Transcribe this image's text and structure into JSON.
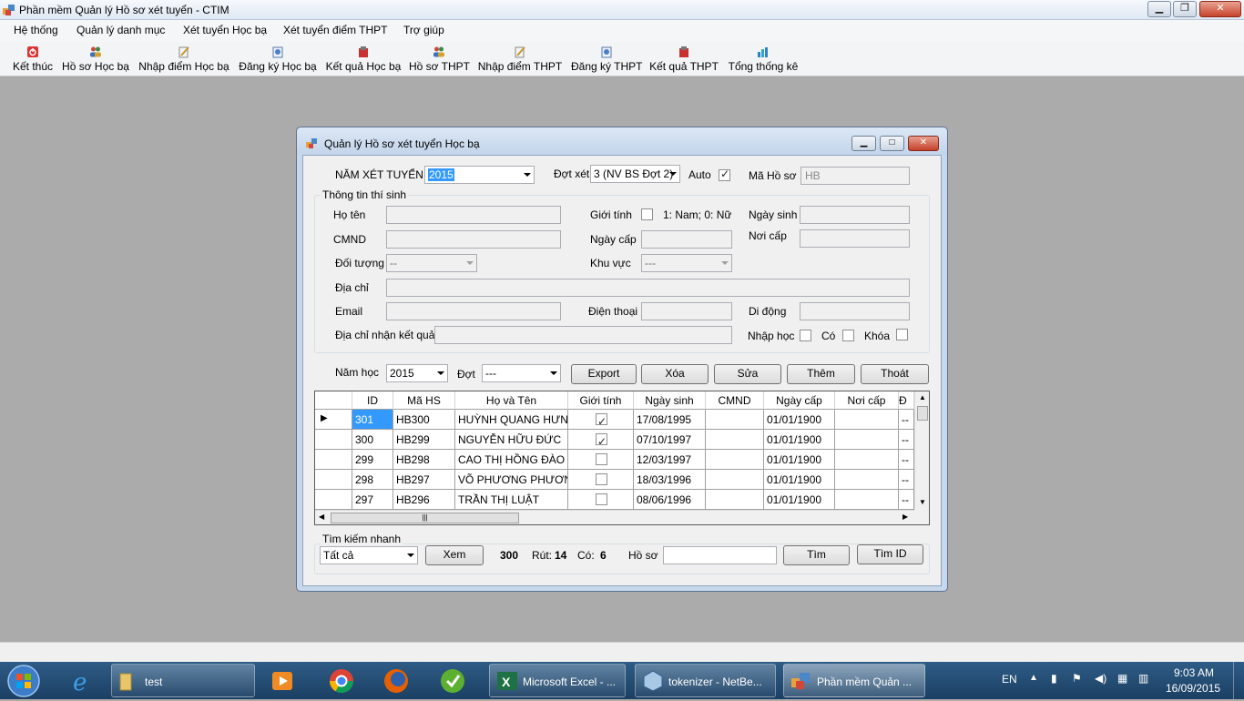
{
  "window": {
    "title": "Phần mềm Quản lý Hồ sơ xét tuyển - CTIM"
  },
  "menu": [
    "Hệ thống",
    "Quản lý danh mục",
    "Xét tuyển Học bạ",
    "Xét tuyển điểm THPT",
    "Trợ giúp"
  ],
  "toolbar": [
    "Kết thúc",
    "Hồ sơ Học bạ",
    "Nhập điểm Học bạ",
    "Đăng ký Học bạ",
    "Kết quả Học bạ",
    "Hồ sơ THPT",
    "Nhập điểm THPT",
    "Đăng ký THPT",
    "Kết quả THPT",
    "Tổng thống kê"
  ],
  "child": {
    "title": "Quản lý Hồ sơ xét tuyển Học bạ",
    "nam_xet_tuyen_label": "NĂM XÉT TUYỂN",
    "nam_xet_tuyen_value": "2015",
    "dot_xet_label": "Đợt xét",
    "dot_xet_value": "3 (NV BS Đợt 2)",
    "auto_label": "Auto",
    "ma_ho_so_label": "Mã Hồ sơ",
    "ma_ho_so_value": "HB",
    "group_title": "Thông tin thí sinh",
    "ho_ten_label": "Họ tên",
    "gioi_tinh_label": "Giới tính",
    "gioi_tinh_hint": "1: Nam; 0: Nữ",
    "ngay_sinh_label": "Ngày sinh",
    "cmnd_label": "CMND",
    "ngay_cap_label": "Ngày cấp",
    "noi_cap_label": "Nơi cấp",
    "doi_tuong_label": "Đối tượng",
    "doi_tuong_value": "--",
    "khu_vuc_label": "Khu vực",
    "khu_vuc_value": "---",
    "dia_chi_label": "Địa chỉ",
    "email_label": "Email",
    "dien_thoai_label": "Điện thoại",
    "di_dong_label": "Di động",
    "dia_chi_nhan_label": "Địa chỉ nhận kết quả",
    "nhap_hoc_label": "Nhập học",
    "co_label": "Có",
    "khoa_label": "Khóa",
    "nam_hoc_label": "Năm học",
    "nam_hoc_value": "2015",
    "dot_label": "Đợt",
    "dot_value": "---",
    "buttons": [
      "Export",
      "Xóa",
      "Sửa",
      "Thêm",
      "Thoát"
    ]
  },
  "grid": {
    "columns": [
      "ID",
      "Mã HS",
      "Họ và Tên",
      "Giới tính",
      "Ngày sinh",
      "CMND",
      "Ngày cấp",
      "Nơi cấp",
      "Đ"
    ],
    "rows": [
      {
        "id": "301",
        "ma": "HB300",
        "ten": "HUỲNH QUANG HƯNG",
        "gioi": true,
        "ngay_sinh": "17/08/1995",
        "cmnd": "",
        "ngay_cap": "01/01/1900",
        "noi_cap": "",
        "d": "--"
      },
      {
        "id": "300",
        "ma": "HB299",
        "ten": "NGUYỄN HỮU ĐỨC",
        "gioi": true,
        "ngay_sinh": "07/10/1997",
        "cmnd": "",
        "ngay_cap": "01/01/1900",
        "noi_cap": "",
        "d": "--"
      },
      {
        "id": "299",
        "ma": "HB298",
        "ten": "CAO THỊ HỒNG ĐÀO",
        "gioi": false,
        "ngay_sinh": "12/03/1997",
        "cmnd": "",
        "ngay_cap": "01/01/1900",
        "noi_cap": "",
        "d": "--"
      },
      {
        "id": "298",
        "ma": "HB297",
        "ten": "VÕ PHƯƠNG PHƯƠNG",
        "gioi": false,
        "ngay_sinh": "18/03/1996",
        "cmnd": "",
        "ngay_cap": "01/01/1900",
        "noi_cap": "",
        "d": "--"
      },
      {
        "id": "297",
        "ma": "HB296",
        "ten": "TRẦN THỊ LUẬT",
        "gioi": false,
        "ngay_sinh": "08/06/1996",
        "cmnd": "",
        "ngay_cap": "01/01/1900",
        "noi_cap": "",
        "d": "--"
      }
    ]
  },
  "search": {
    "title": "Tìm kiếm nhanh",
    "filter_value": "Tất cả",
    "xem": "Xem",
    "total": "300",
    "rut_label": "Rút:",
    "rut_value": "14",
    "co_label": "Có:",
    "co_value": "6",
    "ho_so_label": "Hồ sơ",
    "tim": "Tìm",
    "tim_id": "Tìm ID"
  },
  "taskbar": {
    "tasks": [
      "test",
      "Microsoft Excel - ...",
      "tokenizer - NetBe...",
      "Phần mềm Quản ..."
    ],
    "lang": "EN",
    "time": "9:03 AM",
    "date": "16/09/2015"
  },
  "colors": {
    "selection": "#3399ff",
    "taskbar": "#1b3f63"
  }
}
